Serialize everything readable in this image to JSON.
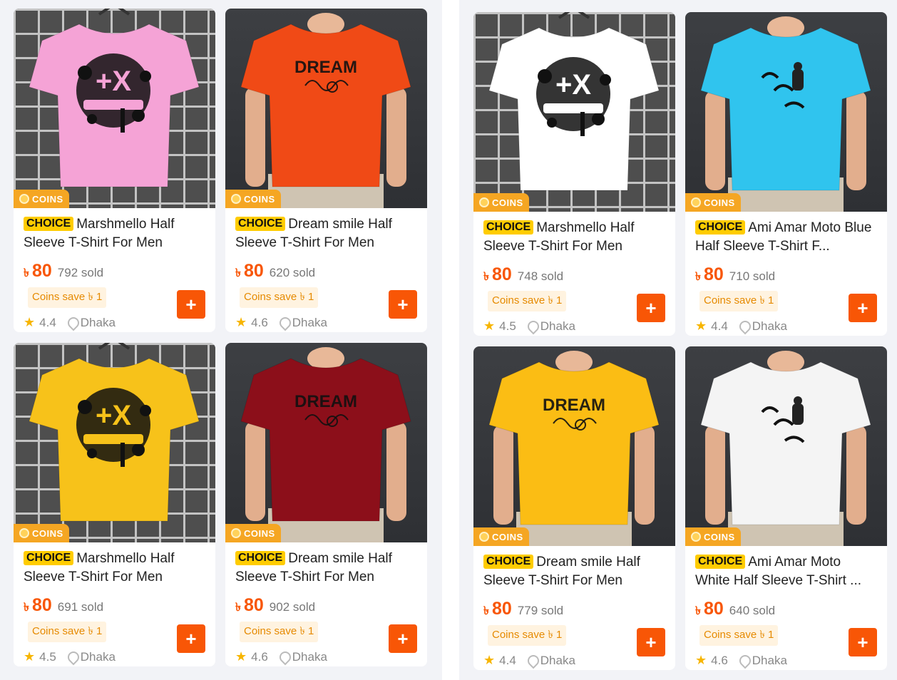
{
  "colors": {
    "accent": "#f85606",
    "choice": "#ffcc00",
    "coins": "#f5a623"
  },
  "badge": {
    "coins": "COINS",
    "choice": "CHOICE"
  },
  "currency": "৳",
  "products": [
    {
      "title": "Marshmello Half Sleeve T-Shirt For Men",
      "price": "80",
      "sold": "792 sold",
      "coins_save": "Coins save ৳ 1",
      "rating": "4.4",
      "location": "Dhaka",
      "shirt_color": "#f5a3d6",
      "design": "marshmello",
      "bg": "wall"
    },
    {
      "title": "Dream smile Half Sleeve T-Shirt For Men",
      "price": "80",
      "sold": "620 sold",
      "coins_save": "Coins save ৳ 1",
      "rating": "4.6",
      "location": "Dhaka",
      "shirt_color": "#f04a16",
      "design": "dream",
      "bg": "studio"
    },
    {
      "title": "Marshmello Half Sleeve T-Shirt For Men",
      "price": "80",
      "sold": "748 sold",
      "coins_save": "Coins save ৳ 1",
      "rating": "4.5",
      "location": "Dhaka",
      "shirt_color": "#ffffff",
      "design": "marshmello",
      "bg": "wall"
    },
    {
      "title": "Ami Amar Moto Blue Half Sleeve T-Shirt F...",
      "price": "80",
      "sold": "710 sold",
      "coins_save": "Coins save ৳ 1",
      "rating": "4.4",
      "location": "Dhaka",
      "shirt_color": "#30c4ee",
      "design": "bangla",
      "bg": "studio"
    },
    {
      "title": "Marshmello Half Sleeve T-Shirt For Men",
      "price": "80",
      "sold": "691 sold",
      "coins_save": "Coins save ৳ 1",
      "rating": "4.5",
      "location": "Dhaka",
      "shirt_color": "#f7c21a",
      "design": "marshmello",
      "bg": "wall"
    },
    {
      "title": "Dream smile Half Sleeve T-Shirt For Men",
      "price": "80",
      "sold": "902 sold",
      "coins_save": "Coins save ৳ 1",
      "rating": "4.6",
      "location": "Dhaka",
      "shirt_color": "#8c0f1a",
      "design": "dream",
      "bg": "studio"
    },
    {
      "title": "Dream smile Half Sleeve T-Shirt For Men",
      "price": "80",
      "sold": "779 sold",
      "coins_save": "Coins save ৳ 1",
      "rating": "4.4",
      "location": "Dhaka",
      "shirt_color": "#fbbd14",
      "design": "dream",
      "bg": "studio"
    },
    {
      "title": "Ami Amar Moto White Half Sleeve T-Shirt ...",
      "price": "80",
      "sold": "640 sold",
      "coins_save": "Coins save ৳ 1",
      "rating": "4.6",
      "location": "Dhaka",
      "shirt_color": "#f4f4f4",
      "design": "bangla",
      "bg": "studio"
    }
  ]
}
